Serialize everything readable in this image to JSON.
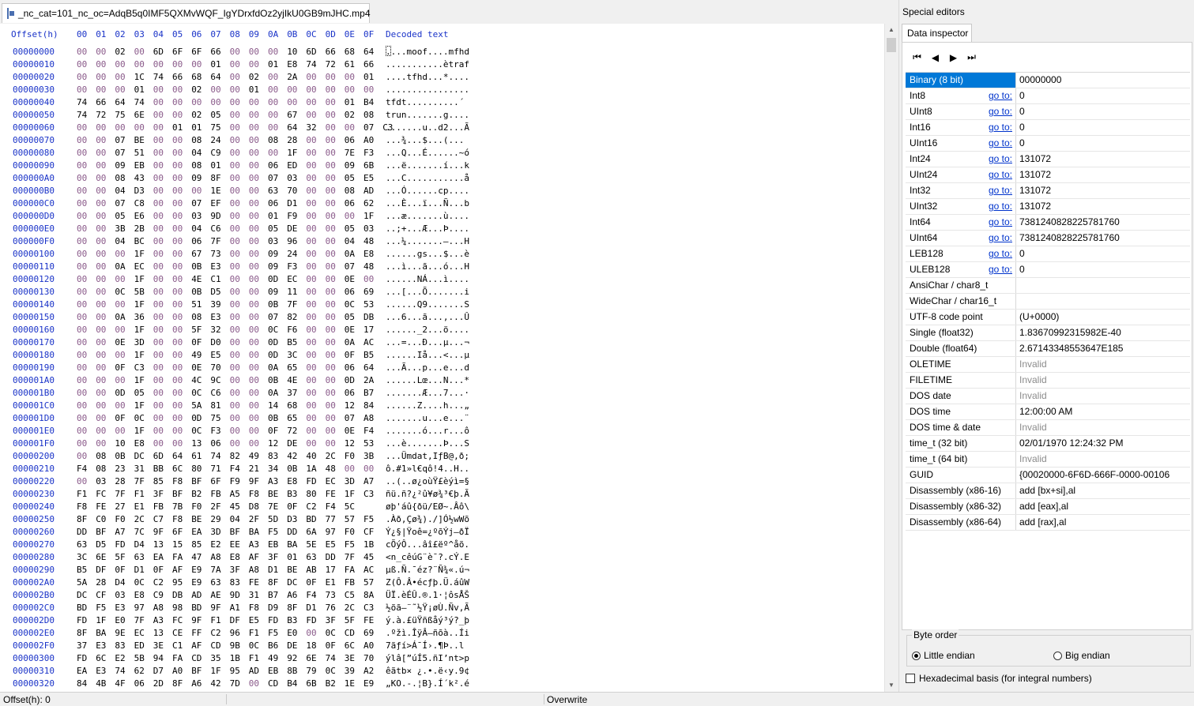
{
  "file_tab": {
    "title": "_nc_cat=101_nc_oc=AdqB5q0IMF5QXMvWQF_IgYDrxfdOz2yjIkU0GB9mJHC.mp4"
  },
  "hex": {
    "header_offset": "Offset(h)",
    "header_cols": [
      "00",
      "01",
      "02",
      "03",
      "04",
      "05",
      "06",
      "07",
      "08",
      "09",
      "0A",
      "0B",
      "0C",
      "0D",
      "0E",
      "0F"
    ],
    "header_text": "Decoded text",
    "rows": [
      {
        "o": "00000000",
        "b": "00 00 02 00 6D 6F 6F 66 00 00 00 10 6D 66 68 64",
        "t": "....moof....mfhd"
      },
      {
        "o": "00000010",
        "b": "00 00 00 00 00 00 00 01 00 00 01 E8 74 72 61 66",
        "t": "...........ètraf"
      },
      {
        "o": "00000020",
        "b": "00 00 00 1C 74 66 68 64 00 02 00 2A 00 00 00 01",
        "t": "....tfhd...*...."
      },
      {
        "o": "00000030",
        "b": "00 00 00 01 00 00 02 00 00 01 00 00 00 00 00 00",
        "t": "................"
      },
      {
        "o": "00000040",
        "b": "74 66 64 74 00 00 00 00 00 00 00 00 00 00 01 B4",
        "t": "tfdt..........´"
      },
      {
        "o": "00000050",
        "b": "74 72 75 6E 00 00 02 05 00 00 00 67 00 00 02 08",
        "t": "trun.......g...."
      },
      {
        "o": "00000060",
        "b": "00 00 00 00 00 01 01 75 00 00 00 64 32 00 00 07 C3",
        "t": ".......u..d2...Ã"
      },
      {
        "o": "00000070",
        "b": "00 00 07 BE 00 00 08 24 00 00 08 28 00 00 06 A0",
        "t": "...¾...$...(... "
      },
      {
        "o": "00000080",
        "b": "00 00 07 51 00 00 04 C9 00 00 00 1F 00 00 7E F3",
        "t": "...Q...É......~ó"
      },
      {
        "o": "00000090",
        "b": "00 00 09 EB 00 00 08 01 00 00 06 ED 00 00 09 6B",
        "t": "...ë.......í...k"
      },
      {
        "o": "000000A0",
        "b": "00 00 08 43 00 00 09 8F 00 00 07 03 00 00 05 E5",
        "t": "...C...........å"
      },
      {
        "o": "000000B0",
        "b": "00 00 04 D3 00 00 00 1E 00 00 63 70 00 00 08 AD",
        "t": "...Ó......cp...."
      },
      {
        "o": "000000C0",
        "b": "00 00 07 C8 00 00 07 EF 00 00 06 D1 00 00 06 62",
        "t": "...È...ï...Ñ...b"
      },
      {
        "o": "000000D0",
        "b": "00 00 05 E6 00 00 03 9D 00 00 01 F9 00 00 00 1F",
        "t": "...æ.......ù...."
      },
      {
        "o": "000000E0",
        "b": "00 00 3B 2B 00 00 04 C6 00 00 05 DE 00 00 05 03",
        "t": "..;+...Æ...Þ...."
      },
      {
        "o": "000000F0",
        "b": "00 00 04 BC 00 00 06 7F 00 00 03 96 00 00 04 48",
        "t": "...¼.......–...H"
      },
      {
        "o": "00000100",
        "b": "00 00 00 1F 00 00 67 73 00 00 09 24 00 00 0A E8",
        "t": "......gs...$...è"
      },
      {
        "o": "00000110",
        "b": "00 00 0A EC 00 00 0B E3 00 00 09 F3 00 00 07 48",
        "t": "...ì...ã...ó...H"
      },
      {
        "o": "00000120",
        "b": "00 00 00 1F 00 00 4E C1 00 00 0D EC 00 00 0E 00",
        "t": "......NÁ...ì...."
      },
      {
        "o": "00000130",
        "b": "00 00 0C 5B 00 00 0B D5 00 00 09 11 00 00 06 69",
        "t": "...[...Õ.......i"
      },
      {
        "o": "00000140",
        "b": "00 00 00 1F 00 00 51 39 00 00 0B 7F 00 00 0C 53",
        "t": "......Q9.......S"
      },
      {
        "o": "00000150",
        "b": "00 00 0A 36 00 00 08 E3 00 00 07 82 00 00 05 DB",
        "t": "...6...ã...‚...Û"
      },
      {
        "o": "00000160",
        "b": "00 00 00 1F 00 00 5F 32 00 00 0C F6 00 00 0E 17",
        "t": "......_2...ö...."
      },
      {
        "o": "00000170",
        "b": "00 00 0E 3D 00 00 0F D0 00 00 0D B5 00 00 0A AC",
        "t": "...=...Ð...µ...¬"
      },
      {
        "o": "00000180",
        "b": "00 00 00 1F 00 00 49 E5 00 00 0D 3C 00 00 0F B5",
        "t": "......Iå...<...µ"
      },
      {
        "o": "00000190",
        "b": "00 00 0F C3 00 00 0E 70 00 00 0A 65 00 00 06 64",
        "t": "...Ã...p...e...d"
      },
      {
        "o": "000001A0",
        "b": "00 00 00 1F 00 00 4C 9C 00 00 0B 4E 00 00 0D 2A",
        "t": "......Lœ...N...*"
      },
      {
        "o": "000001B0",
        "b": "00 00 0D 05 00 00 0C C6 00 00 0A 37 00 00 06 B7",
        "t": ".......Æ...7...·"
      },
      {
        "o": "000001C0",
        "b": "00 00 00 1F 00 00 5A 81 00 00 14 68 00 00 12 84",
        "t": "......Z....h...„"
      },
      {
        "o": "000001D0",
        "b": "00 00 0F 0C 00 00 0D 75 00 00 0B 65 00 00 07 A8",
        "t": ".......u...e...¨"
      },
      {
        "o": "000001E0",
        "b": "00 00 00 1F 00 00 0C F3 00 00 0F 72 00 00 0E F4",
        "t": ".......ó...r...ô"
      },
      {
        "o": "000001F0",
        "b": "00 00 10 E8 00 00 13 06 00 00 12 DE 00 00 12 53",
        "t": "...è.......Þ...S"
      },
      {
        "o": "00000200",
        "b": "00 08 0B DC 6D 64 61 74 82 49 83 42 40 2C F0 3B",
        "t": "...Ümdat,IƒB@,ð;"
      },
      {
        "o": "00000210",
        "b": "F4 08 23 31 BB 6C 80 71 F4 21 34 0B 1A 48 00 00",
        "t": "ô.#1»l€qô!4..H.."
      },
      {
        "o": "00000220",
        "b": "00 03 28 7F 85 F8 BF 6F F9 9F A3 E8 FD EC 3D A7",
        "t": "..(..ø¿oùŸ£èýì=§"
      },
      {
        "o": "00000230",
        "b": "F1 FC 7F F1 3F BF B2 FB A5 F8 BE B3 80 FE 1F C3",
        "t": "ñü.ñ?¿²û¥ø¾³€þ.Ã"
      },
      {
        "o": "00000240",
        "b": "F8 FE 27 E1 FB 7B F0 2F 45 D8 7E 0F C2 F4 5C",
        "t": "øþ'áû{ðü/EØ~.Âô\\"
      },
      {
        "o": "00000250",
        "b": "8F C0 F0 2C C7 F8 BE 29 04 2F 5D D3 BD 77 57 F5",
        "t": ".Àð,Çø¾)./]Ó½wWõ"
      },
      {
        "o": "00000260",
        "b": "DD BF A7 7C 9F 6F EA 3D BF BA F5 DD 6A 97 F0 CF",
        "t": "Ý¿§|Ÿoê=¿ºõÝj—ðÏ"
      },
      {
        "o": "00000270",
        "b": "63 D5 FD D4 13 15 85 E2 EE A3 EB BA 5E E5 F5 1B",
        "t": "cÕýÔ...âî£ëº^åõ."
      },
      {
        "o": "00000280",
        "b": "3C 6E 5F 63 EA FA 47 A8 E8 AF 3F 01 63 DD 7F 45",
        "t": "<n_cêúG¨è¯?.cÝ.E"
      },
      {
        "o": "00000290",
        "b": "B5 DF 0F D1 0F AF E9 7A 3F A8 D1 BE AB 17 FA AC",
        "t": "µß.Ñ.¯éz?¨Ñ¾«.ú¬"
      },
      {
        "o": "000002A0",
        "b": "5A 28 D4 0C C2 95 E9 63 83 FE 8F DC 0F E1 FB 57",
        "t": "Z(Ô.Â•écƒþ.Ü.áûW"
      },
      {
        "o": "000002B0",
        "b": "DC CF 03 E8 C9 DB AD AE 9D 31 B7 A6 F4 73 C5 8A",
        "t": "ÜÏ.èÉÛ.®.1·¦ôsÅŠ"
      },
      {
        "o": "000002C0",
        "b": "BD F5 E3 97 A8 98 BD 9F A1 F8 D9 8F D1 76 2C C3",
        "t": "½õã—¨˜½Ÿ¡øÙ.Ñv,Ã"
      },
      {
        "o": "000002D0",
        "b": "FD 1F E0 7F A3 FC 9F F1 DF E5 FD B3 FD 3F 5F FE",
        "t": "ý.à.£üŸñßåý³ý?_þ"
      },
      {
        "o": "000002E0",
        "b": "8F BA 9E EC 13 CE FF C2 96 F1 F5 E0 00 0C CD 69",
        "t": ".ºžì.ÎÿÂ–ñõà..Íi"
      },
      {
        "o": "000002F0",
        "b": "37 E3 83 ED 3E C1 AF CD 9B 0C B6 DE 18 0F 6C A0",
        "t": "7ãƒí>Á¯Í›.¶Þ..l "
      },
      {
        "o": "00000300",
        "b": "FD 6C E2 5B 94 FA CD 35 1B F1 49 92 6E 74 3E 70",
        "t": "ýlâ[”úÍ5.ñI’nt>p"
      },
      {
        "o": "00000310",
        "b": "EA E3 74 62 D7 A0 BF 1F 95 AD EB 8B 79 0C 39 A2",
        "t": "êãtb× ¿.•.ë‹y.9¢"
      },
      {
        "o": "00000320",
        "b": "84 4B 4F 06 2D 8F A6 42 7D 00 CD B4 6B B2 1E E9",
        "t": "„KO.-.¦B}.Í´k².é"
      }
    ]
  },
  "side": {
    "title": "Special editors",
    "tab": "Data inspector",
    "nav_icons": [
      "first-icon",
      "prev-icon",
      "next-icon",
      "last-icon"
    ],
    "goto_label": "go to:",
    "rows": [
      {
        "name": "Binary (8 bit)",
        "value": "00000000",
        "sel": true
      },
      {
        "name": "Int8",
        "value": "0",
        "goto": true
      },
      {
        "name": "UInt8",
        "value": "0",
        "goto": true
      },
      {
        "name": "Int16",
        "value": "0",
        "goto": true
      },
      {
        "name": "UInt16",
        "value": "0",
        "goto": true
      },
      {
        "name": "Int24",
        "value": "131072",
        "goto": true
      },
      {
        "name": "UInt24",
        "value": "131072",
        "goto": true
      },
      {
        "name": "Int32",
        "value": "131072",
        "goto": true
      },
      {
        "name": "UInt32",
        "value": "131072",
        "goto": true
      },
      {
        "name": "Int64",
        "value": "7381240828225781760",
        "goto": true
      },
      {
        "name": "UInt64",
        "value": "7381240828225781760",
        "goto": true
      },
      {
        "name": "LEB128",
        "value": "0",
        "goto": true
      },
      {
        "name": "ULEB128",
        "value": "0",
        "goto": true
      },
      {
        "name": "AnsiChar / char8_t",
        "value": ""
      },
      {
        "name": "WideChar / char16_t",
        "value": ""
      },
      {
        "name": "UTF-8 code point",
        "value": "   (U+0000)"
      },
      {
        "name": "Single (float32)",
        "value": "1.83670992315982E-40"
      },
      {
        "name": "Double (float64)",
        "value": "2.67143348553647E185"
      },
      {
        "name": "OLETIME",
        "value": "Invalid",
        "inv": true
      },
      {
        "name": "FILETIME",
        "value": "Invalid",
        "inv": true
      },
      {
        "name": "DOS date",
        "value": "Invalid",
        "inv": true
      },
      {
        "name": "DOS time",
        "value": "12:00:00 AM"
      },
      {
        "name": "DOS time & date",
        "value": "Invalid",
        "inv": true
      },
      {
        "name": "time_t (32 bit)",
        "value": "02/01/1970 12:24:32 PM"
      },
      {
        "name": "time_t (64 bit)",
        "value": "Invalid",
        "inv": true
      },
      {
        "name": "GUID",
        "value": "{00020000-6F6D-666F-0000-00106"
      },
      {
        "name": "Disassembly (x86-16)",
        "value": "add [bx+si],al"
      },
      {
        "name": "Disassembly (x86-32)",
        "value": "add [eax],al"
      },
      {
        "name": "Disassembly (x86-64)",
        "value": "add [rax],al"
      }
    ],
    "byte_order_label": "Byte order",
    "little_endian": "Little endian",
    "big_endian": "Big endian",
    "hex_basis": "Hexadecimal basis (for integral numbers)"
  },
  "status": {
    "offset": "Offset(h): 0",
    "mode": "Overwrite"
  }
}
